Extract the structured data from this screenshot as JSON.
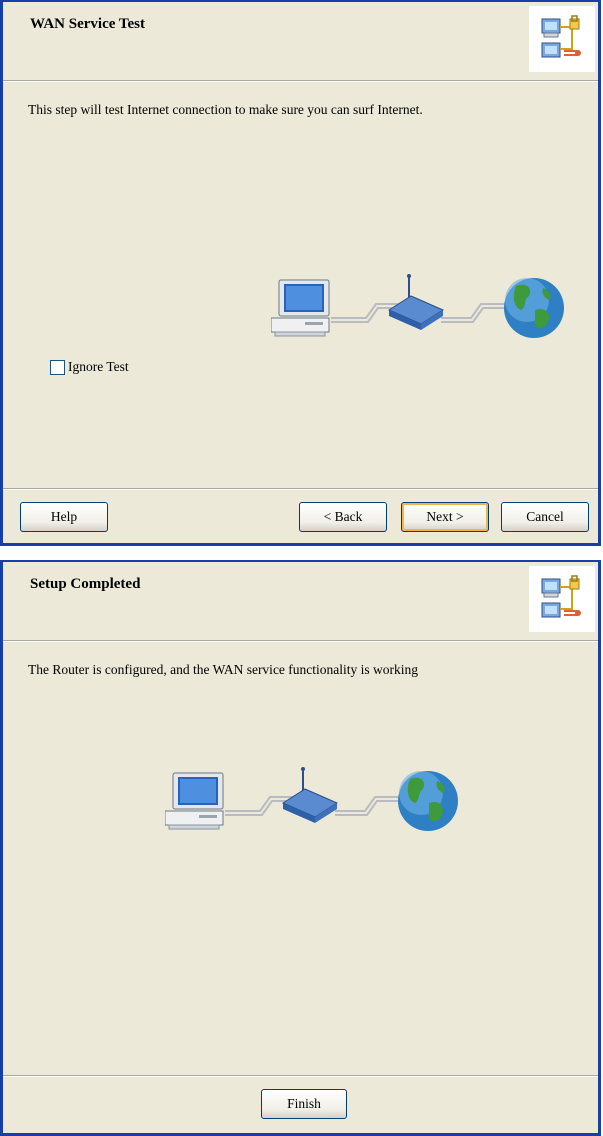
{
  "wan_test": {
    "title": "WAN Service Test",
    "description": "This step will test Internet connection to make sure you can surf Internet.",
    "ignore_test_label": "Ignore Test",
    "ignore_test_checked": false,
    "buttons": {
      "help": "Help",
      "back": "< Back",
      "next": "Next >",
      "cancel": "Cancel"
    }
  },
  "setup_completed": {
    "title": "Setup Completed",
    "description": "The Router is configured, and the WAN service functionality is working",
    "buttons": {
      "finish": "Finish"
    }
  },
  "icons": {
    "header": "network-wizard-icon",
    "computer": "computer-icon",
    "router": "router-icon",
    "globe": "globe-icon"
  },
  "colors": {
    "dialog_bg": "#ece9d8",
    "window_border": "#1a3ea8",
    "button_border": "#003c74",
    "default_button_focus": "#f5b44a"
  }
}
